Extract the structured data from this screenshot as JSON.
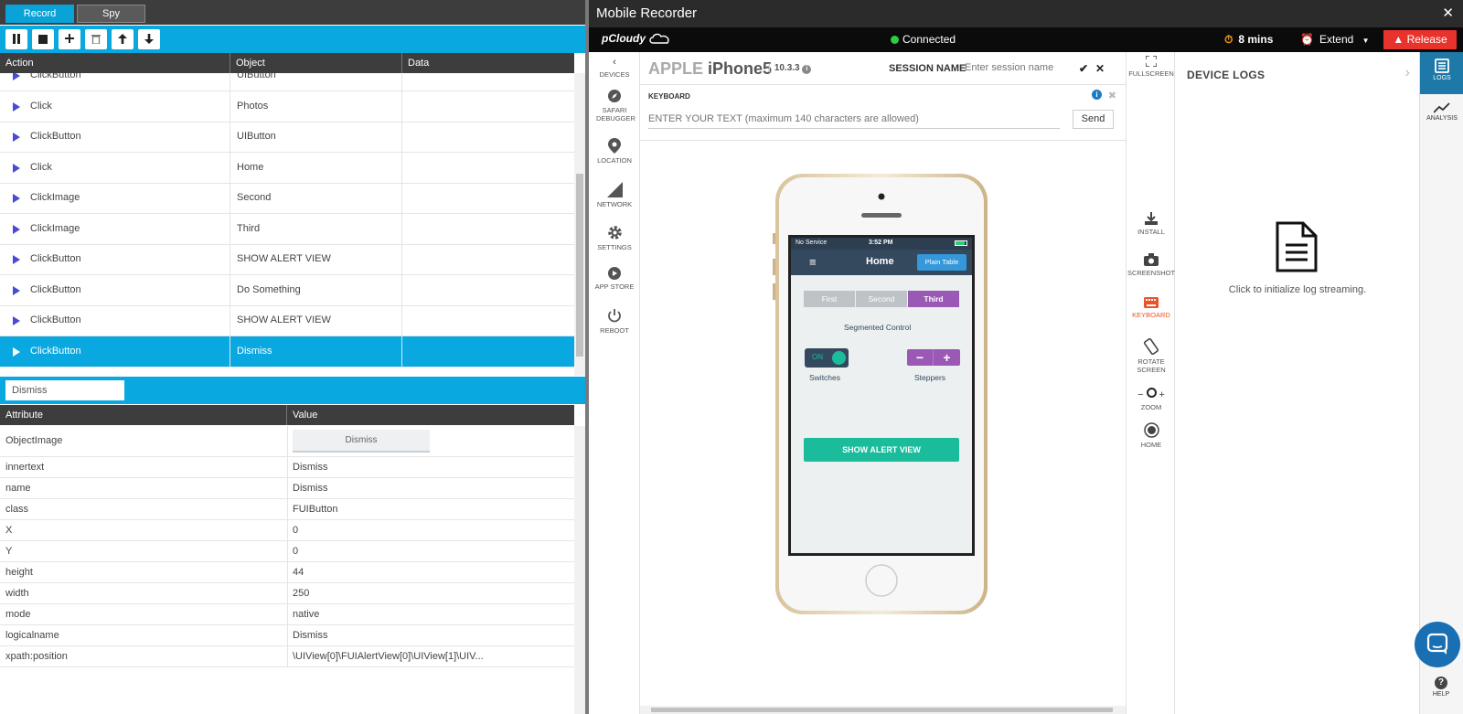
{
  "left": {
    "tabs": {
      "record": "Record",
      "spy": "Spy"
    },
    "toolbar": [
      "pause",
      "stop",
      "add",
      "delete",
      "move-up",
      "move-down"
    ],
    "grid": {
      "headers": {
        "action": "Action",
        "object": "Object",
        "data": "Data"
      },
      "rows": [
        {
          "action": "ClickButton",
          "object": "UIButton",
          "data": ""
        },
        {
          "action": "Click",
          "object": "Photos",
          "data": ""
        },
        {
          "action": "ClickButton",
          "object": "UIButton",
          "data": ""
        },
        {
          "action": "Click",
          "object": "Home",
          "data": ""
        },
        {
          "action": "ClickImage",
          "object": "Second",
          "data": ""
        },
        {
          "action": "ClickImage",
          "object": "Third",
          "data": ""
        },
        {
          "action": "ClickButton",
          "object": "SHOW ALERT VIEW",
          "data": ""
        },
        {
          "action": "ClickButton",
          "object": "Do Something",
          "data": ""
        },
        {
          "action": "ClickButton",
          "object": "SHOW ALERT VIEW",
          "data": ""
        },
        {
          "action": "ClickButton",
          "object": "Dismiss",
          "data": "",
          "selected": true
        }
      ]
    },
    "finder_value": "Dismiss",
    "attributes": {
      "headers": {
        "attribute": "Attribute",
        "value": "Value"
      },
      "object_image_label": "Dismiss",
      "rows": [
        {
          "key": "ObjectImage",
          "value": ""
        },
        {
          "key": "innertext",
          "value": "Dismiss"
        },
        {
          "key": "name",
          "value": "Dismiss"
        },
        {
          "key": "class",
          "value": "FUIButton"
        },
        {
          "key": "X",
          "value": "0"
        },
        {
          "key": "Y",
          "value": "0"
        },
        {
          "key": "height",
          "value": "44"
        },
        {
          "key": "width",
          "value": "250"
        },
        {
          "key": "mode",
          "value": "native"
        },
        {
          "key": "logicalname",
          "value": "Dismiss"
        },
        {
          "key": "xpath:position",
          "value": "\\UIView[0]\\FUIAlertView[0]\\UIView[1]\\UIV..."
        }
      ]
    }
  },
  "right": {
    "window_title": "Mobile Recorder",
    "close": "✕",
    "header": {
      "logo": "pCloudy",
      "status": "Connected",
      "timer": "8 mins",
      "extend": "Extend",
      "release": "Release"
    },
    "leftnav": [
      "DEVICES",
      "SAFARI DEBUGGER",
      "LOCATION",
      "NETWORK",
      "SETTINGS",
      "APP STORE",
      "REBOOT"
    ],
    "device": {
      "brand": "APPLE",
      "model": "iPhone5",
      "os_version": "10.3.3",
      "session_label": "SESSION NAME",
      "session_placeholder": "Enter session name"
    },
    "keyboard": {
      "label": "KEYBOARD",
      "placeholder": "ENTER YOUR TEXT (maximum 140 characters are allowed)",
      "send": "Send"
    },
    "phone": {
      "status_left": "No Service",
      "status_time": "3:52 PM",
      "nav_title": "Home",
      "nav_button": "Plain Table",
      "segments": [
        "First",
        "Second",
        "Third"
      ],
      "segment_label": "Segmented Control",
      "switch_text": "ON",
      "switch_label": "Switches",
      "stepper_label": "Steppers",
      "alert_button": "SHOW ALERT VIEW"
    },
    "tools": [
      "FULLSCREEN",
      "INSTALL",
      "SCREENSHOT",
      "KEYBOARD",
      "ROTATE SCREEN",
      "ZOOM",
      "HOME"
    ],
    "logs": {
      "title": "DEVICE LOGS",
      "message": "Click to initialize log streaming."
    },
    "sidebar": [
      "LOGS",
      "ANALYSIS",
      "HELP"
    ]
  }
}
